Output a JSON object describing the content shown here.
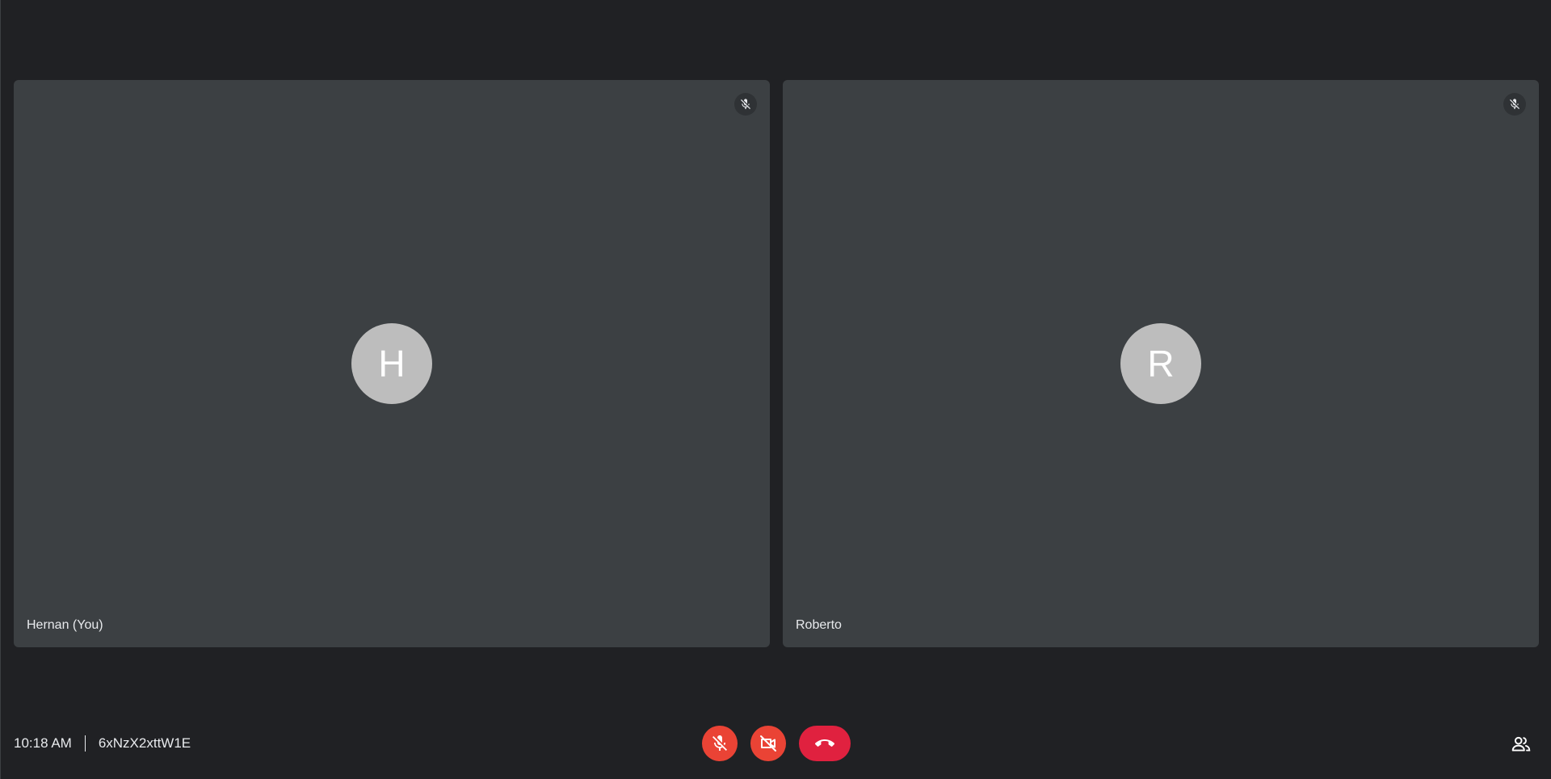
{
  "participants": [
    {
      "initial": "H",
      "name": "Hernan (You)",
      "muted_icon": "mic-off-icon"
    },
    {
      "initial": "R",
      "name": "Roberto",
      "muted_icon": "mic-off-icon"
    }
  ],
  "meeting": {
    "time": "10:18 AM",
    "code": "6xNzX2xttW1E"
  },
  "controls": {
    "mic": {
      "icon": "mic-off-icon",
      "state": "off"
    },
    "camera": {
      "icon": "video-off-icon",
      "state": "off"
    },
    "hangup": {
      "icon": "call-end-icon"
    },
    "people": {
      "icon": "people-icon"
    }
  },
  "colors": {
    "background": "#202124",
    "tile": "#3c4043",
    "avatar": "#bdbdbd",
    "danger": "#ea4335",
    "hangup": "#e0213f"
  }
}
